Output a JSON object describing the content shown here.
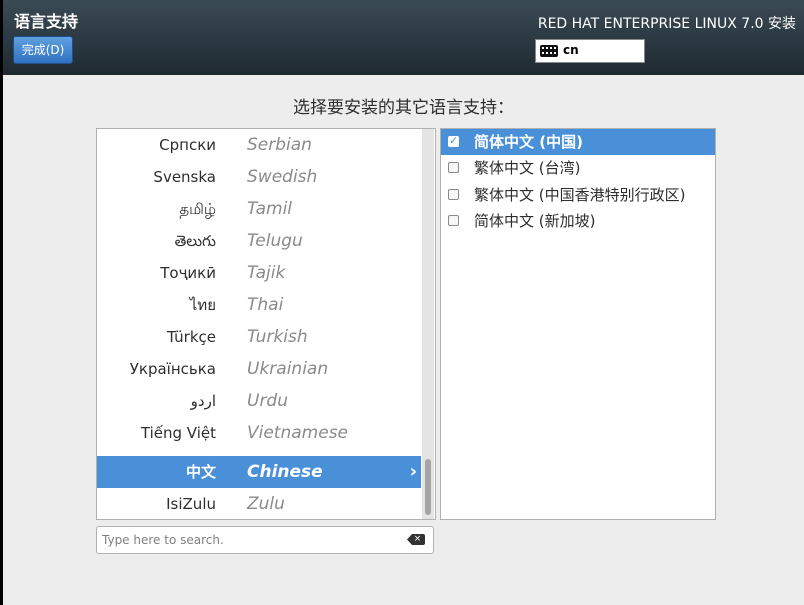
{
  "header": {
    "title": "语言支持",
    "done_button": "完成(D)",
    "product": "RED HAT ENTERPRISE LINUX 7.0 安装",
    "keyboard_layout": "cn"
  },
  "prompt": "选择要安装的其它语言支持：",
  "languages": [
    {
      "native": "Српски",
      "english": "Serbian"
    },
    {
      "native": "Svenska",
      "english": "Swedish"
    },
    {
      "native": "தமிழ்",
      "english": "Tamil"
    },
    {
      "native": "తెలుగు",
      "english": "Telugu"
    },
    {
      "native": "Тоҷикӣ",
      "english": "Tajik"
    },
    {
      "native": "ไทย",
      "english": "Thai"
    },
    {
      "native": "Türkçe",
      "english": "Turkish"
    },
    {
      "native": "Українська",
      "english": "Ukrainian"
    },
    {
      "native": "اردو",
      "english": "Urdu"
    },
    {
      "native": "Tiếng Việt",
      "english": "Vietnamese"
    },
    {
      "native": "中文",
      "english": "Chinese",
      "selected": true
    },
    {
      "native": "IsiZulu",
      "english": "Zulu"
    }
  ],
  "search": {
    "placeholder": "Type here to search.",
    "value": ""
  },
  "locales": [
    {
      "label": "简体中文 (中国)",
      "checked": true
    },
    {
      "label": "繁体中文 (台湾)",
      "checked": false
    },
    {
      "label": "繁体中文 (中国香港特别行政区)",
      "checked": false
    },
    {
      "label": "简体中文 (新加坡)",
      "checked": false
    }
  ],
  "icons": {
    "keyboard": "keyboard-icon",
    "clear": "clear-text-icon",
    "chevron": "chevron-right-icon"
  }
}
